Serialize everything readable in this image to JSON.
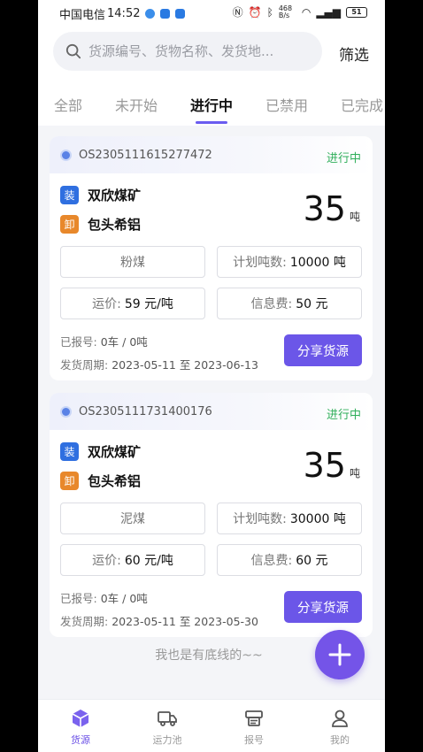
{
  "status_bar": {
    "carrier": "中国电信",
    "time": "14:52",
    "net_speed": "468 B/s",
    "battery": "51"
  },
  "search": {
    "placeholder": "货源编号、货物名称、发货地..."
  },
  "filter_label": "筛选",
  "tabs": [
    {
      "label": "全部"
    },
    {
      "label": "未开始"
    },
    {
      "label": "进行中"
    },
    {
      "label": "已禁用"
    },
    {
      "label": "已完成"
    }
  ],
  "active_tab": "进行中",
  "cards": [
    {
      "code": "OS2305111615277472",
      "status": "进行中",
      "load_badge": "装",
      "load_place": "双欣煤矿",
      "unload_badge": "卸",
      "unload_place": "包头希铝",
      "tons": "35",
      "tons_unit": "吨",
      "goods": "粉煤",
      "plan_label": "计划吨数:",
      "plan_value": "10000 吨",
      "price_label": "运价:",
      "price_value": "59 元/吨",
      "info_label": "信息费:",
      "info_value": "50 元",
      "reported_label": "已报号:",
      "reported_value": "0车 / 0吨",
      "period_label": "发货周期:",
      "period_value": "2023-05-11 至 2023-06-13",
      "share_label": "分享货源"
    },
    {
      "code": "OS2305111731400176",
      "status": "进行中",
      "load_badge": "装",
      "load_place": "双欣煤矿",
      "unload_badge": "卸",
      "unload_place": "包头希铝",
      "tons": "35",
      "tons_unit": "吨",
      "goods": "泥煤",
      "plan_label": "计划吨数:",
      "plan_value": "30000 吨",
      "price_label": "运价:",
      "price_value": "60 元/吨",
      "info_label": "信息费:",
      "info_value": "60 元",
      "reported_label": "已报号:",
      "reported_value": "0车 / 0吨",
      "period_label": "发货周期:",
      "period_value": "2023-05-11 至 2023-05-30",
      "share_label": "分享货源"
    }
  ],
  "bottom_note": "我也是有底线的~~",
  "nav": [
    {
      "label": "货源",
      "icon": "box-icon"
    },
    {
      "label": "运力池",
      "icon": "truck-icon"
    },
    {
      "label": "报号",
      "icon": "printer-icon"
    },
    {
      "label": "我的",
      "icon": "user-icon"
    }
  ],
  "colors": {
    "accent": "#6b56e8",
    "status_green": "#2fae5a",
    "load_blue": "#2f6fe0",
    "unload_orange": "#e8882b"
  }
}
